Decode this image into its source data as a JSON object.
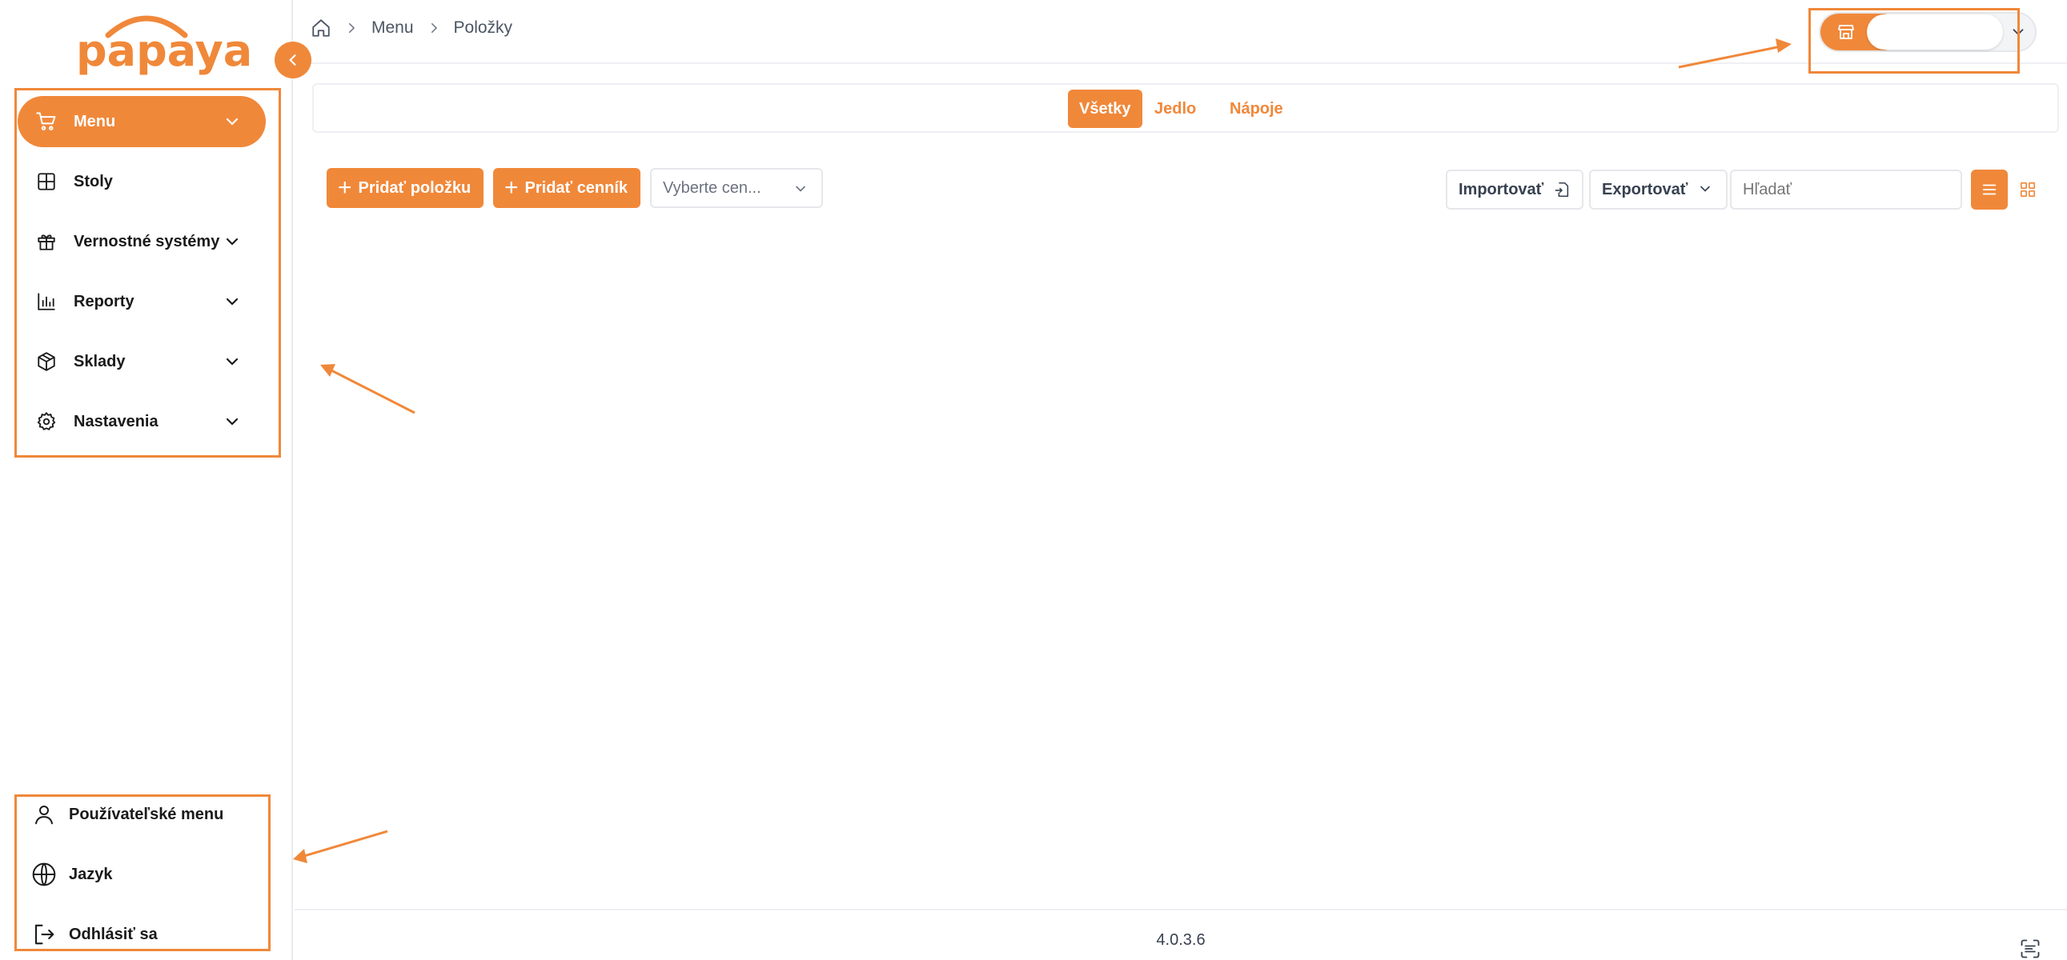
{
  "app": {
    "logo_text": "papaya",
    "version": "4.0.3.6",
    "accent": "#f0883a"
  },
  "breadcrumb": {
    "items": [
      "Menu",
      "Položky"
    ]
  },
  "sidebar": {
    "items": [
      {
        "label": "Menu",
        "icon": "cart-icon",
        "active": true,
        "expandable": true
      },
      {
        "label": "Stoly",
        "icon": "table-grid-icon",
        "active": false,
        "expandable": false
      },
      {
        "label": "Vernostné systémy",
        "icon": "gift-icon",
        "active": false,
        "expandable": true
      },
      {
        "label": "Reporty",
        "icon": "bar-chart-icon",
        "active": false,
        "expandable": true
      },
      {
        "label": "Sklady",
        "icon": "box-icon",
        "active": false,
        "expandable": true
      },
      {
        "label": "Nastavenia",
        "icon": "gear-icon",
        "active": false,
        "expandable": true
      }
    ],
    "bottom": [
      {
        "label": "Používateľské menu",
        "icon": "user-icon"
      },
      {
        "label": "Jazyk",
        "icon": "globe-icon"
      },
      {
        "label": "Odhlásiť sa",
        "icon": "logout-icon"
      }
    ]
  },
  "tabs": [
    {
      "label": "Všetky",
      "active": true
    },
    {
      "label": "Jedlo",
      "active": false
    },
    {
      "label": "Nápoje",
      "active": false
    }
  ],
  "toolbar": {
    "add_item": "Pridať položku",
    "add_pricelist": "Pridať cenník",
    "pricelist_select": "Vyberte cen...",
    "import": "Importovať",
    "export": "Exportovať",
    "search_placeholder": "Hľadať",
    "view_mode": "list"
  }
}
